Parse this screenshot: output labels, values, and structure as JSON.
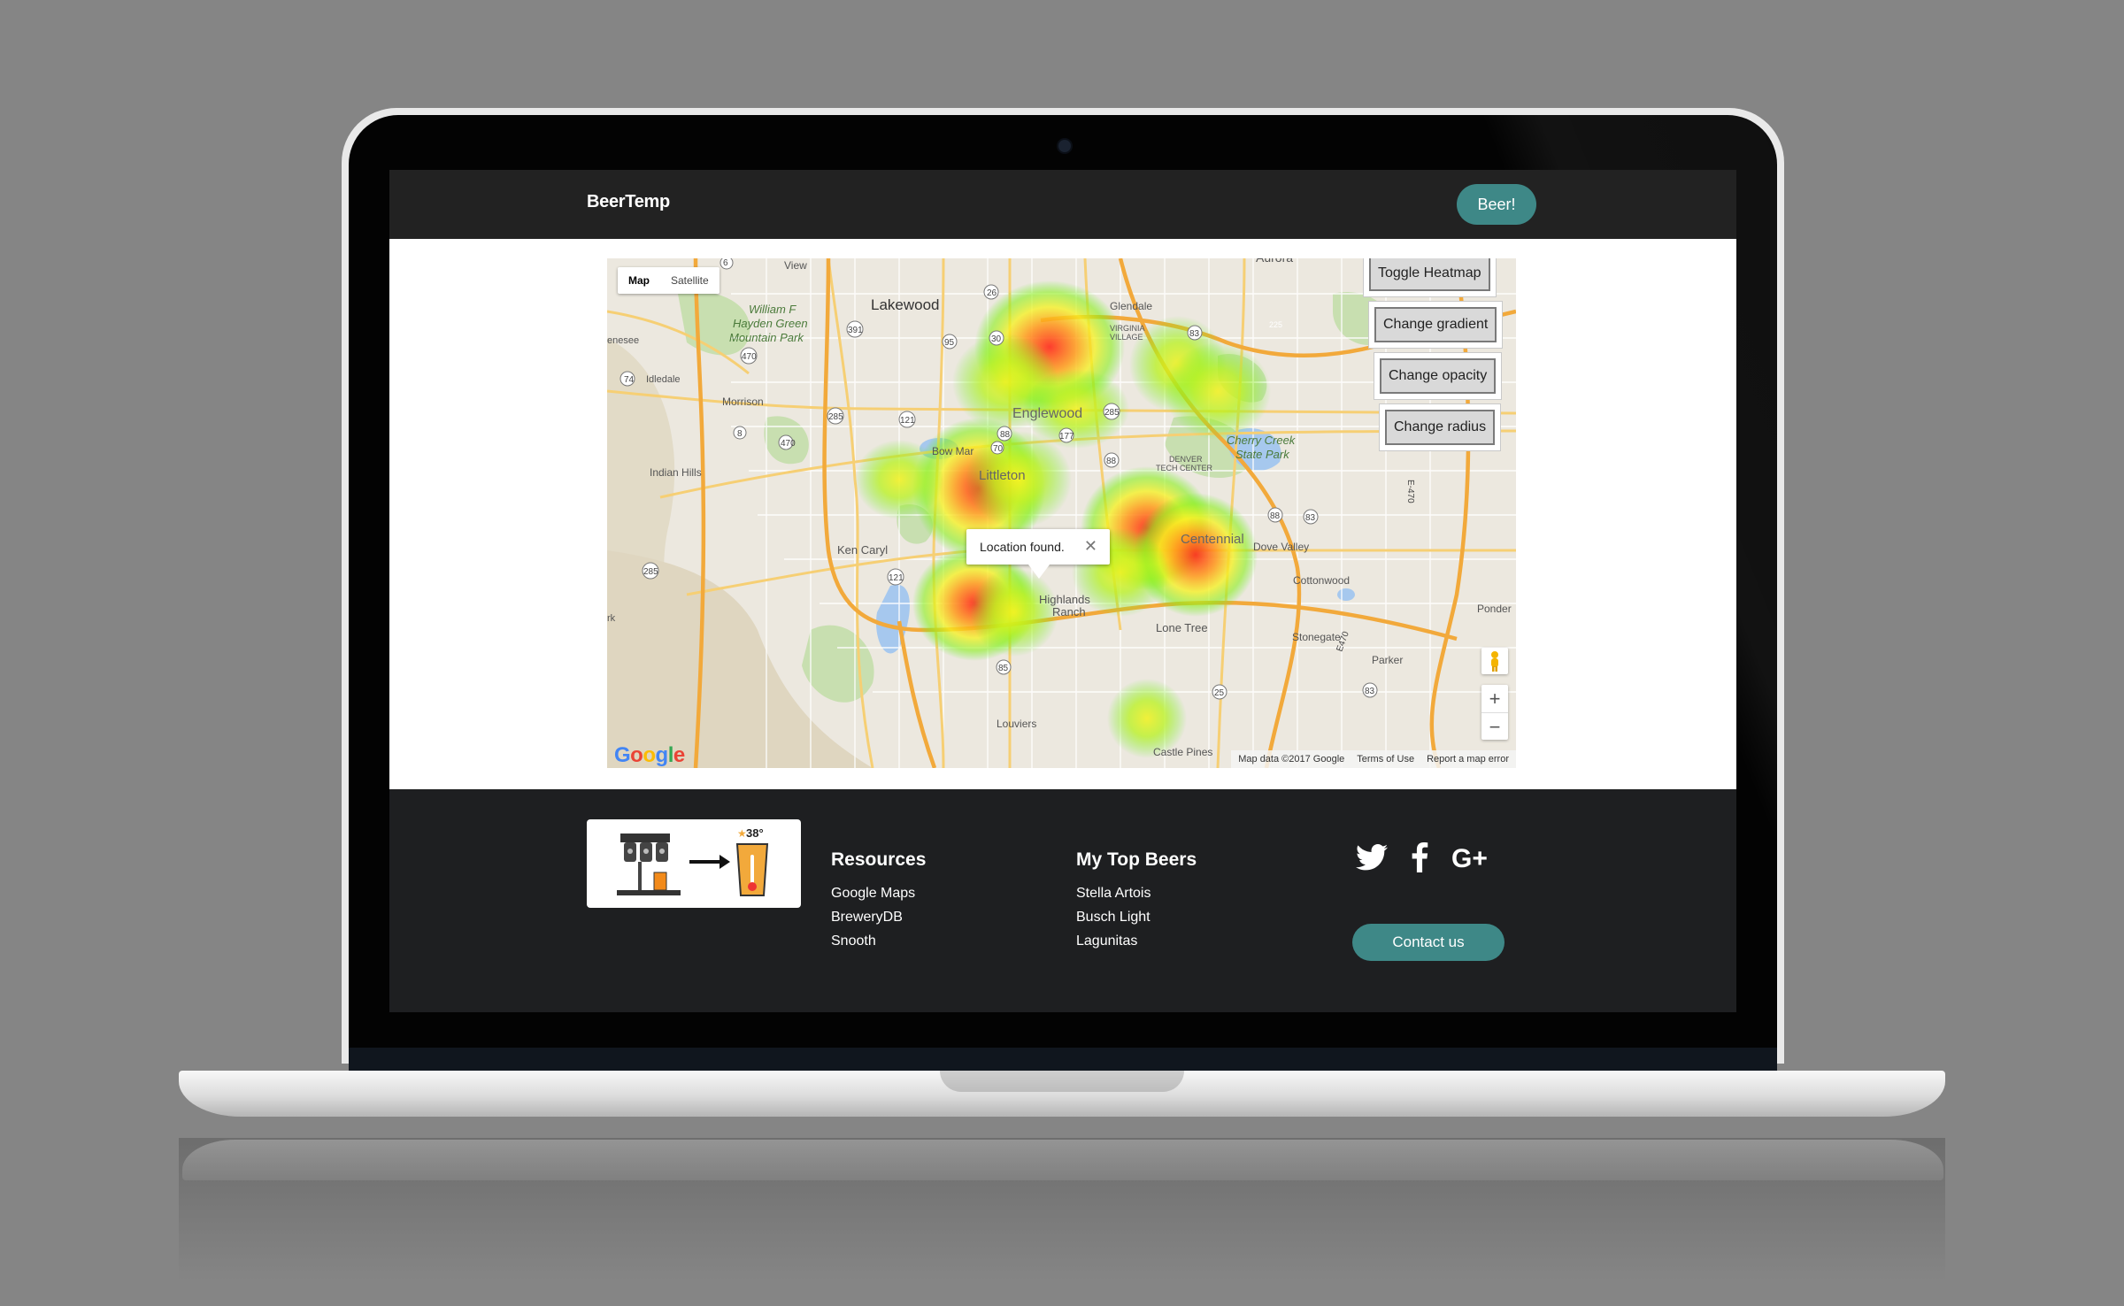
{
  "navbar": {
    "brand": "BeerTemp",
    "beer_button": "Beer!"
  },
  "map": {
    "type_toggle": {
      "map_label": "Map",
      "satellite_label": "Satellite",
      "selected": "Map"
    },
    "controls": [
      "Toggle Heatmap",
      "Change gradient",
      "Change opacity",
      "Change radius"
    ],
    "info_window": {
      "text": "Location found.",
      "close_icon": "close-icon"
    },
    "zoom": {
      "in": "+",
      "out": "−"
    },
    "google_logo": "Google",
    "attribution": {
      "data": "Map data ©2017 Google",
      "terms": "Terms of Use",
      "report": "Report a map error"
    },
    "place_labels": [
      "View",
      "Aurora",
      "Lakewood",
      "Glendale",
      "William F Hayden Green Mountain Park",
      "enesee",
      "Idledale",
      "Morrison",
      "Englewood",
      "Bow Mar",
      "Cherry Creek State Park",
      "Indian Hills",
      "Littleton",
      "DENVER TECH CENTER",
      "VIRGINIA VILLAGE",
      "Centennial",
      "Dove Valley",
      "Ken Caryl",
      "Cottonwood",
      "Highlands Ranch",
      "Lone Tree",
      "Stonegate",
      "Ponder",
      "Parker",
      "Louviers",
      "Castle Pines",
      "rk"
    ],
    "road_shields": [
      "6",
      "26",
      "391",
      "95",
      "30",
      "83",
      "225",
      "74",
      "470",
      "285",
      "121",
      "88",
      "177",
      "8",
      "85",
      "70",
      "285",
      "470",
      "88",
      "83",
      "E-470",
      "121",
      "85",
      "25",
      "83",
      "E470"
    ],
    "heatmap_gradient": [
      "#66ff00",
      "#ffff00",
      "#ff9900",
      "#ff0000"
    ]
  },
  "footer": {
    "logo": {
      "temp_label": "38°"
    },
    "resources": {
      "heading": "Resources",
      "links": [
        "Google Maps",
        "BreweryDB",
        "Snooth"
      ]
    },
    "top_beers": {
      "heading": "My Top Beers",
      "links": [
        "Stella Artois",
        "Busch Light",
        "Lagunitas"
      ]
    },
    "social_icons": [
      "twitter-icon",
      "facebook-icon",
      "google-plus-icon"
    ],
    "contact_button": "Contact us"
  },
  "colors": {
    "navbar_bg": "#222222",
    "footer_bg": "#1e1f21",
    "accent": "#3e8887"
  }
}
